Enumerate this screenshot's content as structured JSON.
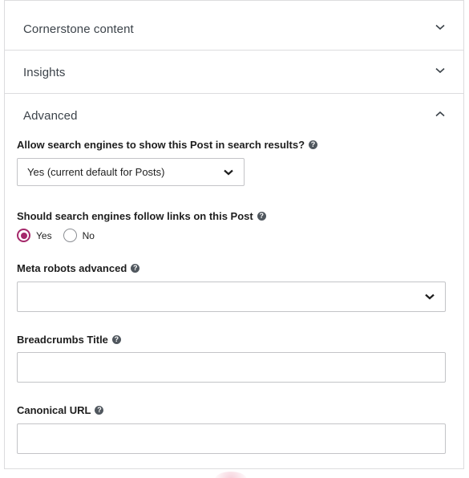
{
  "sections": {
    "cornerstone": {
      "title": "Cornerstone content",
      "icon": "chevron-down-icon"
    },
    "insights": {
      "title": "Insights",
      "icon": "chevron-down-icon"
    },
    "advanced": {
      "title": "Advanced",
      "icon": "chevron-up-icon"
    }
  },
  "advanced": {
    "search_visibility": {
      "label": "Allow search engines to show this Post in search results?",
      "selected": "Yes (current default for Posts)"
    },
    "follow_links": {
      "label": "Should search engines follow links on this Post",
      "options": [
        "Yes",
        "No"
      ],
      "selected": "Yes"
    },
    "meta_robots": {
      "label": "Meta robots advanced",
      "selected": ""
    },
    "breadcrumbs_title": {
      "label": "Breadcrumbs Title",
      "value": ""
    },
    "canonical_url": {
      "label": "Canonical URL",
      "value": ""
    }
  },
  "colors": {
    "accent": "#a4286a",
    "border": "#dcdcde",
    "input_border": "#c3c4c7"
  }
}
